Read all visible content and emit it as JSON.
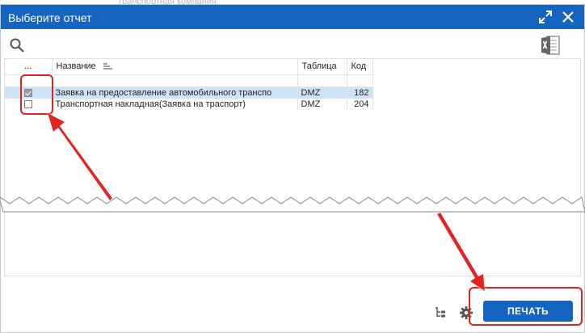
{
  "background_peek": "Транспортная компания",
  "dialog": {
    "title": "Выберите отчет",
    "accent_color": "#1565c0"
  },
  "toolbar": {
    "search_icon": "search-icon",
    "export_icon": "excel-export-icon"
  },
  "table": {
    "columns": [
      "...",
      "Название",
      "Таблица",
      "Код"
    ],
    "rows": [
      {
        "checked": true,
        "name": "Заявка на предоставление автомобильного транспо",
        "table": "DMZ",
        "code": "182"
      },
      {
        "checked": false,
        "name": "Транспортная накладная(Заявка на траспорт)",
        "table": "DMZ",
        "code": "204"
      }
    ]
  },
  "footer": {
    "print_label": "ПЕЧАТЬ"
  },
  "annotations": {
    "highlight_color": "#e52020"
  }
}
